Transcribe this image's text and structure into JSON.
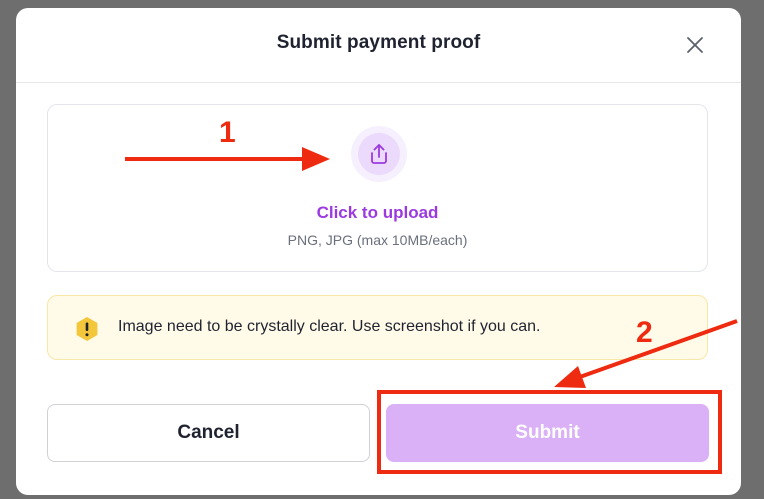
{
  "dialog": {
    "title": "Submit payment proof",
    "close_icon": "close-icon"
  },
  "upload": {
    "icon": "upload-icon",
    "label": "Click to upload",
    "hint": "PNG, JPG (max 10MB/each)"
  },
  "notice": {
    "icon": "warning-icon",
    "text": "Image need to be crystally clear. Use screenshot if you can."
  },
  "actions": {
    "cancel_label": "Cancel",
    "submit_label": "Submit",
    "submit_enabled": false
  },
  "annotations": {
    "step1": "1",
    "step2": "2"
  },
  "colors": {
    "accent": "#9b3ae0",
    "submit_disabled_bg": "#dab0f6",
    "notice_bg": "#fffbe8",
    "notice_icon": "#f4c63b",
    "annotation_red": "#ee2a10",
    "backdrop": "#6e6e6e"
  }
}
